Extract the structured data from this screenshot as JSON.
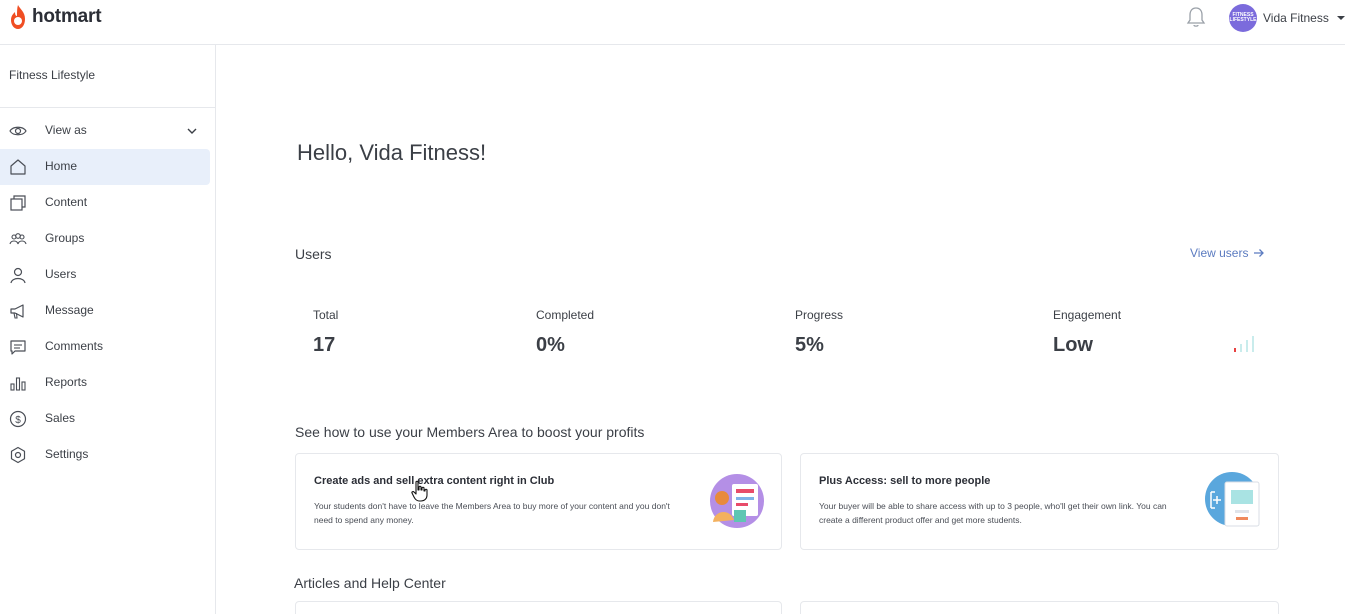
{
  "app": {
    "logo_text": "hotmart"
  },
  "header": {
    "user_name": "Vida Fitness",
    "avatar_text": "FITNESS LIFESTYLE"
  },
  "sidebar": {
    "product_name": "Fitness Lifestyle",
    "items": [
      {
        "label": "View as",
        "icon": "eye-icon"
      },
      {
        "label": "Home",
        "icon": "home-icon",
        "active": true
      },
      {
        "label": "Content",
        "icon": "content-icon"
      },
      {
        "label": "Groups",
        "icon": "groups-icon"
      },
      {
        "label": "Users",
        "icon": "user-icon"
      },
      {
        "label": "Message",
        "icon": "megaphone-icon"
      },
      {
        "label": "Comments",
        "icon": "comment-icon"
      },
      {
        "label": "Reports",
        "icon": "bar-chart-icon"
      },
      {
        "label": "Sales",
        "icon": "dollar-icon"
      },
      {
        "label": "Settings",
        "icon": "gear-icon"
      }
    ]
  },
  "main": {
    "greeting": "Hello, Vida Fitness!",
    "users_section": {
      "title": "Users",
      "view_link": "View users",
      "stats": [
        {
          "label": "Total",
          "value": "17"
        },
        {
          "label": "Completed",
          "value": "0%"
        },
        {
          "label": "Progress",
          "value": "5%"
        },
        {
          "label": "Engagement",
          "value": "Low"
        }
      ]
    },
    "tips_section": {
      "title": "See how to use your Members Area to boost your profits",
      "cards": [
        {
          "title": "Create ads and sell extra content right in Club",
          "text": "Your students don't have to leave the Members Area to buy more of your content and you don't need to spend any money."
        },
        {
          "title": "Plus Access: sell to more people",
          "text": "Your buyer will be able to share access with up to 3 people, who'll get their own link. You can create a different product offer and get more students."
        }
      ]
    },
    "articles_section": {
      "title": "Articles and Help Center"
    }
  },
  "colors": {
    "accent": "#5b7bc0",
    "brand": "#f04e23",
    "active_bg": "#e8effa",
    "avatar": "#7b6bdc"
  }
}
